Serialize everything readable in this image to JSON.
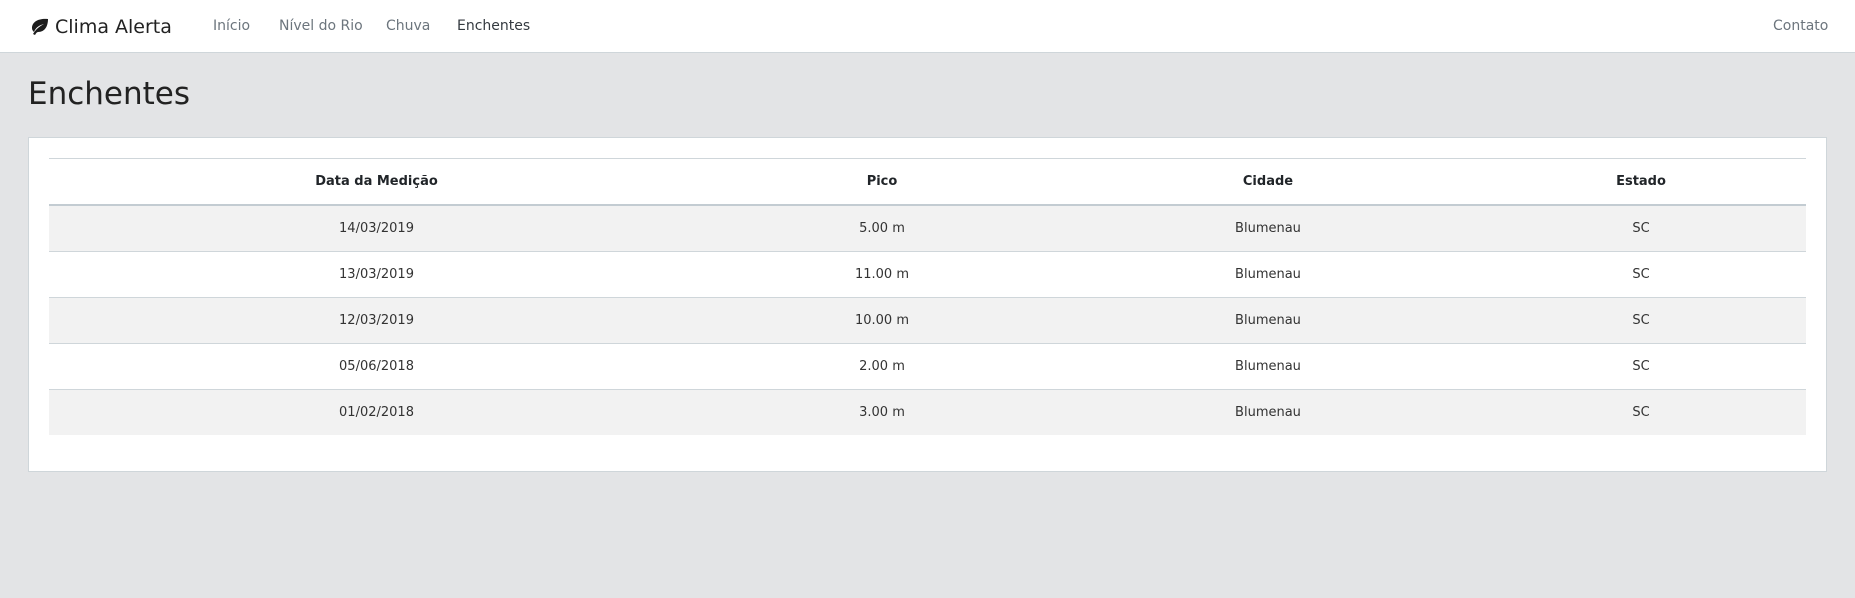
{
  "navbar": {
    "brand": "Clima Alerta",
    "brand_icon": "leaf-icon",
    "links": [
      {
        "label": "Início"
      },
      {
        "label": "Nível do Rio"
      },
      {
        "label": "Chuva"
      },
      {
        "label": "Enchentes",
        "active": true
      }
    ],
    "contact": "Contato"
  },
  "page": {
    "title": "Enchentes"
  },
  "table": {
    "headers": [
      "Data da Medição",
      "Pico",
      "Cidade",
      "Estado"
    ],
    "rows": [
      [
        "14/03/2019",
        "5.00 m",
        "Blumenau",
        "SC"
      ],
      [
        "13/03/2019",
        "11.00 m",
        "Blumenau",
        "SC"
      ],
      [
        "12/03/2019",
        "10.00 m",
        "Blumenau",
        "SC"
      ],
      [
        "05/06/2018",
        "2.00 m",
        "Blumenau",
        "SC"
      ],
      [
        "01/02/2018",
        "3.00 m",
        "Blumenau",
        "SC"
      ]
    ]
  },
  "colors": {
    "background": "#e3e4e6",
    "navbar": "#ffffff",
    "stripe": "#f2f2f2",
    "border": "#cfd6da"
  }
}
